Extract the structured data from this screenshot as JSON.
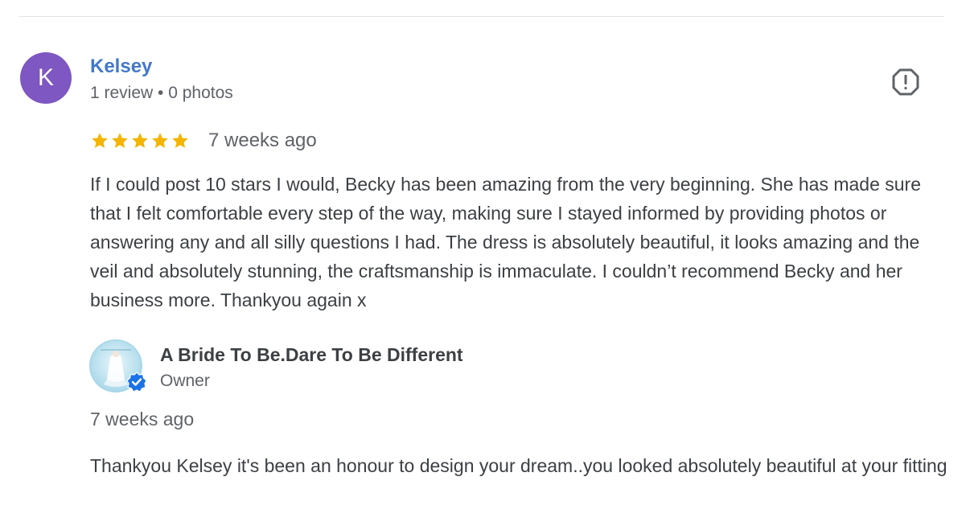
{
  "review": {
    "author": {
      "initial": "K",
      "name": "Kelsey",
      "meta": "1 review • 0 photos",
      "avatar_color": "#7e57c2"
    },
    "rating": 5,
    "rating_max": 5,
    "star_color": "#f4b400",
    "date": "7 weeks ago",
    "text": "If I could post 10 stars I would, Becky has been amazing from the very beginning. She has made sure that I felt comfortable every step of the way, making sure I stayed informed by providing photos or answering any and all silly questions I had. The dress is absolutely beautiful, it looks amazing and the veil and absolutely stunning, the craftsmanship is immaculate. I couldn’t recommend Becky and her business more. Thankyou again x",
    "report_icon": "report-flag-icon"
  },
  "owner_reply": {
    "name": "A Bride To Be.Dare To Be Different",
    "role": "Owner",
    "date": "7 weeks ago",
    "text": "Thankyou Kelsey it's been an honour to design your dream..you looked absolutely beautiful at your fitting",
    "verified_icon": "verified-check-icon",
    "verified_color": "#1a73e8"
  }
}
